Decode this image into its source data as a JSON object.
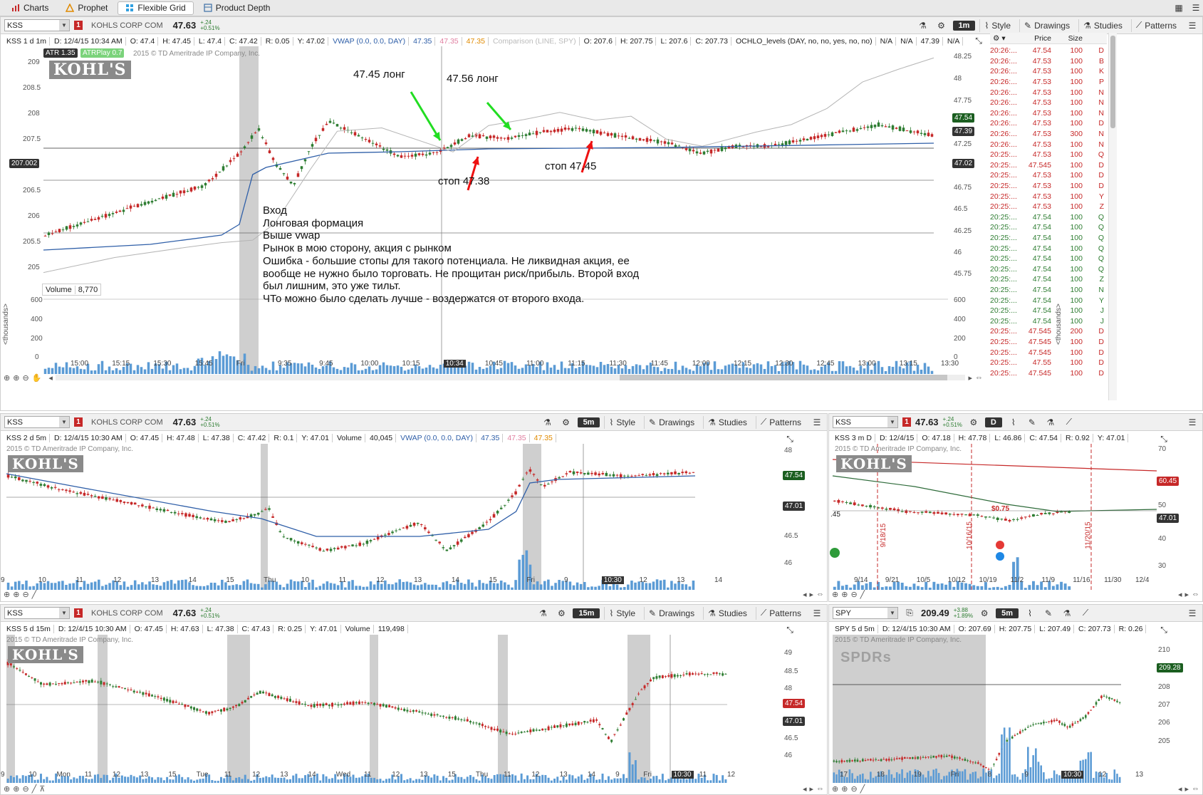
{
  "topbar": {
    "tabs": [
      {
        "label": "Charts"
      },
      {
        "label": "Prophet"
      },
      {
        "label": "Flexible Grid"
      },
      {
        "label": "Product Depth"
      }
    ]
  },
  "main_chart": {
    "symbol": "KSS",
    "link": "1",
    "company": "KOHLS CORP COM",
    "last": "47.63",
    "change": "+.24",
    "change_pct": "+0.51%",
    "aggregation": "1m",
    "buttons": {
      "style": "Style",
      "drawings": "Drawings",
      "studies": "Studies",
      "patterns": "Patterns"
    },
    "info": [
      "KSS 1 d 1m",
      "D: 12/4/15 10:34 AM",
      "O: 47.4",
      "H: 47.45",
      "L: 47.4",
      "C: 47.42",
      "R: 0.05",
      "Y: 47.02",
      "VWAP (0.0, 0.0, DAY)",
      "47.35",
      "47.35",
      "47.35",
      "Comparison (LINE, SPY)",
      "O: 207.6",
      "H: 207.75",
      "L: 207.6",
      "C: 207.73",
      "OCHLO_levels (DAY, no, no, yes, no, no)",
      "N/A",
      "N/A",
      "47.39",
      "N/A"
    ],
    "atr": "ATR 1.35",
    "atrplay": "ATRPlay 0.7",
    "copyright": "2015 © TD Ameritrade IP Company, Inc.",
    "logo": "KOHL'S",
    "left_axis": [
      "209",
      "208.5",
      "208",
      "207.5",
      "207",
      "206.5",
      "206",
      "205.5",
      "205"
    ],
    "left_marker": "207.002",
    "right_axis": [
      "48.25",
      "48",
      "47.75",
      "47.5",
      "47.25",
      "46.75",
      "46.5",
      "46.25",
      "46",
      "45.75"
    ],
    "right_markers": {
      "last": "47.54",
      "level": "47.39",
      "prev": "47.02"
    },
    "volume_label": "Volume",
    "volume_value": "8,770",
    "volume_axis": [
      "600",
      "400",
      "200",
      "0"
    ],
    "volume_unit": "<thousands>",
    "time_axis": [
      "15:00",
      "15:15",
      "15:30",
      "15:45",
      "Fri",
      "9:35",
      "9:45",
      "10:00",
      "10:15",
      "10:34",
      "10:45",
      "11:00",
      "11:15",
      "11:30",
      "11:45",
      "12:00",
      "12:15",
      "12:30",
      "12:45",
      "13:00",
      "13:15",
      "13:30"
    ],
    "cursor_time": "10:34",
    "annotations": {
      "long1": "47.45 лонг",
      "long2": "47.56 лонг",
      "stop1": "стоп 47.38",
      "stop2": "стоп 47.45"
    },
    "notes": [
      "Вход",
      "Лонговая формация",
      "Выше vwap",
      "Рынок в мою сторону, акция с рынком",
      "Ошибка - большие стопы для такого потенциала. Не ликвидная акция, ее",
      "вообще не нужно было торговать. Не прощитан риск/прибыль. Второй вход",
      "был лишним, это уже тильт.",
      "ЧТо можно было сделать лучше - воздержатся от второго входа."
    ]
  },
  "time_sales": {
    "headers": {
      "price": "Price",
      "size": "Size"
    },
    "rows": [
      [
        "20:26:...",
        "47.54",
        "100",
        "D"
      ],
      [
        "20:26:...",
        "47.53",
        "100",
        "B"
      ],
      [
        "20:26:...",
        "47.53",
        "100",
        "K"
      ],
      [
        "20:26:...",
        "47.53",
        "100",
        "P"
      ],
      [
        "20:26:...",
        "47.53",
        "100",
        "N"
      ],
      [
        "20:26:...",
        "47.53",
        "100",
        "N"
      ],
      [
        "20:26:...",
        "47.53",
        "100",
        "N"
      ],
      [
        "20:26:...",
        "47.53",
        "100",
        "D"
      ],
      [
        "20:26:...",
        "47.53",
        "300",
        "N"
      ],
      [
        "20:26:...",
        "47.53",
        "100",
        "N"
      ],
      [
        "20:25:...",
        "47.53",
        "100",
        "Q"
      ],
      [
        "20:25:...",
        "47.545",
        "100",
        "D"
      ],
      [
        "20:25:...",
        "47.53",
        "100",
        "D"
      ],
      [
        "20:25:...",
        "47.53",
        "100",
        "D"
      ],
      [
        "20:25:...",
        "47.53",
        "100",
        "Y"
      ],
      [
        "20:25:...",
        "47.53",
        "100",
        "Z"
      ],
      [
        "20:25:...",
        "47.54",
        "100",
        "Q"
      ],
      [
        "20:25:...",
        "47.54",
        "100",
        "Q"
      ],
      [
        "20:25:...",
        "47.54",
        "100",
        "Q"
      ],
      [
        "20:25:...",
        "47.54",
        "100",
        "Q"
      ],
      [
        "20:25:...",
        "47.54",
        "100",
        "Q"
      ],
      [
        "20:25:...",
        "47.54",
        "100",
        "Q"
      ],
      [
        "20:25:...",
        "47.54",
        "100",
        "Z"
      ],
      [
        "20:25:...",
        "47.54",
        "100",
        "N"
      ],
      [
        "20:25:...",
        "47.54",
        "100",
        "Y"
      ],
      [
        "20:25:...",
        "47.54",
        "100",
        "J"
      ],
      [
        "20:25:...",
        "47.54",
        "100",
        "J"
      ],
      [
        "20:25:...",
        "47.545",
        "200",
        "D"
      ],
      [
        "20:25:...",
        "47.545",
        "100",
        "D"
      ],
      [
        "20:25:...",
        "47.545",
        "100",
        "D"
      ],
      [
        "20:25:...",
        "47.55",
        "100",
        "D"
      ],
      [
        "20:25:...",
        "47.545",
        "100",
        "D"
      ]
    ],
    "green_rows": [
      16,
      17,
      18,
      19,
      20,
      21,
      22,
      23,
      24,
      25,
      26
    ]
  },
  "chart2": {
    "symbol": "KSS",
    "link": "1",
    "company": "KOHLS CORP COM",
    "last": "47.63",
    "change": "+.24",
    "change_pct": "+0.51%",
    "aggregation": "5m",
    "buttons": {
      "style": "Style",
      "drawings": "Drawings",
      "studies": "Studies",
      "patterns": "Patterns"
    },
    "info": [
      "KSS 2 d 5m",
      "D: 12/4/15 10:30 AM",
      "O: 47.45",
      "H: 47.48",
      "L: 47.38",
      "C: 47.42",
      "R: 0.1",
      "Y: 47.01",
      "Volume",
      "40,045",
      "VWAP (0.0, 0.0, DAY)",
      "47.35",
      "47.35",
      "47.35"
    ],
    "copyright": "2015 © TD Ameritrade IP Company, Inc.",
    "logo": "KOHL'S",
    "right_axis": [
      "48",
      "47.5",
      "46.5",
      "46"
    ],
    "last_marker": "47.54",
    "prev_marker": "47.01",
    "time_axis": [
      "9",
      "10",
      "11",
      "12",
      "13",
      "14",
      "15",
      "Thu",
      "10",
      "11",
      "12",
      "13",
      "14",
      "15",
      "Fri",
      "9",
      "10:30",
      "12",
      "13",
      "14"
    ],
    "cursor_time": "10:30"
  },
  "chart3": {
    "symbol": "KSS",
    "link": "1",
    "last": "47.63",
    "change": "+.24",
    "change_pct": "+0.51%",
    "aggregation": "D",
    "info": [
      "KSS 3 m D",
      "D: 12/4/15",
      "O: 47.18",
      "H: 47.78",
      "L: 46.86",
      "C: 47.54",
      "R: 0.92",
      "Y: 47.01"
    ],
    "copyright": "2015 © TD Ameritrade IP Company, Inc.",
    "logo": "KOHL'S",
    "right_axis": [
      "70",
      "50",
      "40",
      "30"
    ],
    "upper_marker": "60.45",
    "last_marker": "47.01",
    "vlines": [
      "9/18/15",
      "10/16/15",
      "11/20/15"
    ],
    "div_label": "$0.75",
    "left_value": ".45",
    "time_axis": [
      "9/14",
      "9/21",
      "10/5",
      "10/12",
      "10/19",
      "11/2",
      "11/9",
      "11/16",
      "11/30",
      "12/4"
    ]
  },
  "chart4": {
    "symbol": "KSS",
    "link": "1",
    "company": "KOHLS CORP COM",
    "last": "47.63",
    "change": "+.24",
    "change_pct": "+0.51%",
    "aggregation": "15m",
    "buttons": {
      "style": "Style",
      "drawings": "Drawings",
      "studies": "Studies",
      "patterns": "Patterns"
    },
    "info": [
      "KSS 5 d 15m",
      "D: 12/4/15 10:30 AM",
      "O: 47.45",
      "H: 47.63",
      "L: 47.38",
      "C: 47.43",
      "R: 0.25",
      "Y: 47.01",
      "Volume",
      "119,498"
    ],
    "copyright": "2015 © TD Ameritrade IP Company, Inc.",
    "logo": "KOHL'S",
    "right_axis": [
      "49",
      "48.5",
      "48",
      "46.5",
      "46"
    ],
    "last_marker": "47.54",
    "prev_marker": "47.01",
    "time_axis": [
      "9",
      "10",
      "Mon",
      "11",
      "12",
      "13",
      "15",
      "Tue",
      "11",
      "12",
      "13",
      "14",
      "Wed",
      "11",
      "12",
      "13",
      "15",
      "Thu",
      "11",
      "12",
      "13",
      "14",
      "9",
      "Fri",
      "10:30",
      "11",
      "12"
    ],
    "cursor_time": "10:30"
  },
  "chart5": {
    "symbol": "SPY",
    "last": "209.49",
    "change": "+3.88",
    "change_pct": "+1.89%",
    "aggregation": "5m",
    "info": [
      "SPY 5 d 5m",
      "D: 12/4/15 10:30 AM",
      "O: 207.69",
      "H: 207.75",
      "L: 207.49",
      "C: 207.73",
      "R: 0.26"
    ],
    "copyright": "2015 © TD Ameritrade IP Company, Inc.",
    "logo": "SPDRs",
    "right_axis": [
      "210",
      "209",
      "208",
      "207",
      "206",
      "205"
    ],
    "last_marker": "209.28",
    "time_axis": [
      "17",
      "18",
      "19",
      "Fri",
      "8",
      "9",
      "10:30",
      "12",
      "13"
    ],
    "cursor_time": "10:30"
  },
  "colors": {
    "up": "#2e7d32",
    "down": "#c62828",
    "vwap": "#2f5fa8",
    "accent": "#31a0e0",
    "volume": "#5b9bd5"
  }
}
